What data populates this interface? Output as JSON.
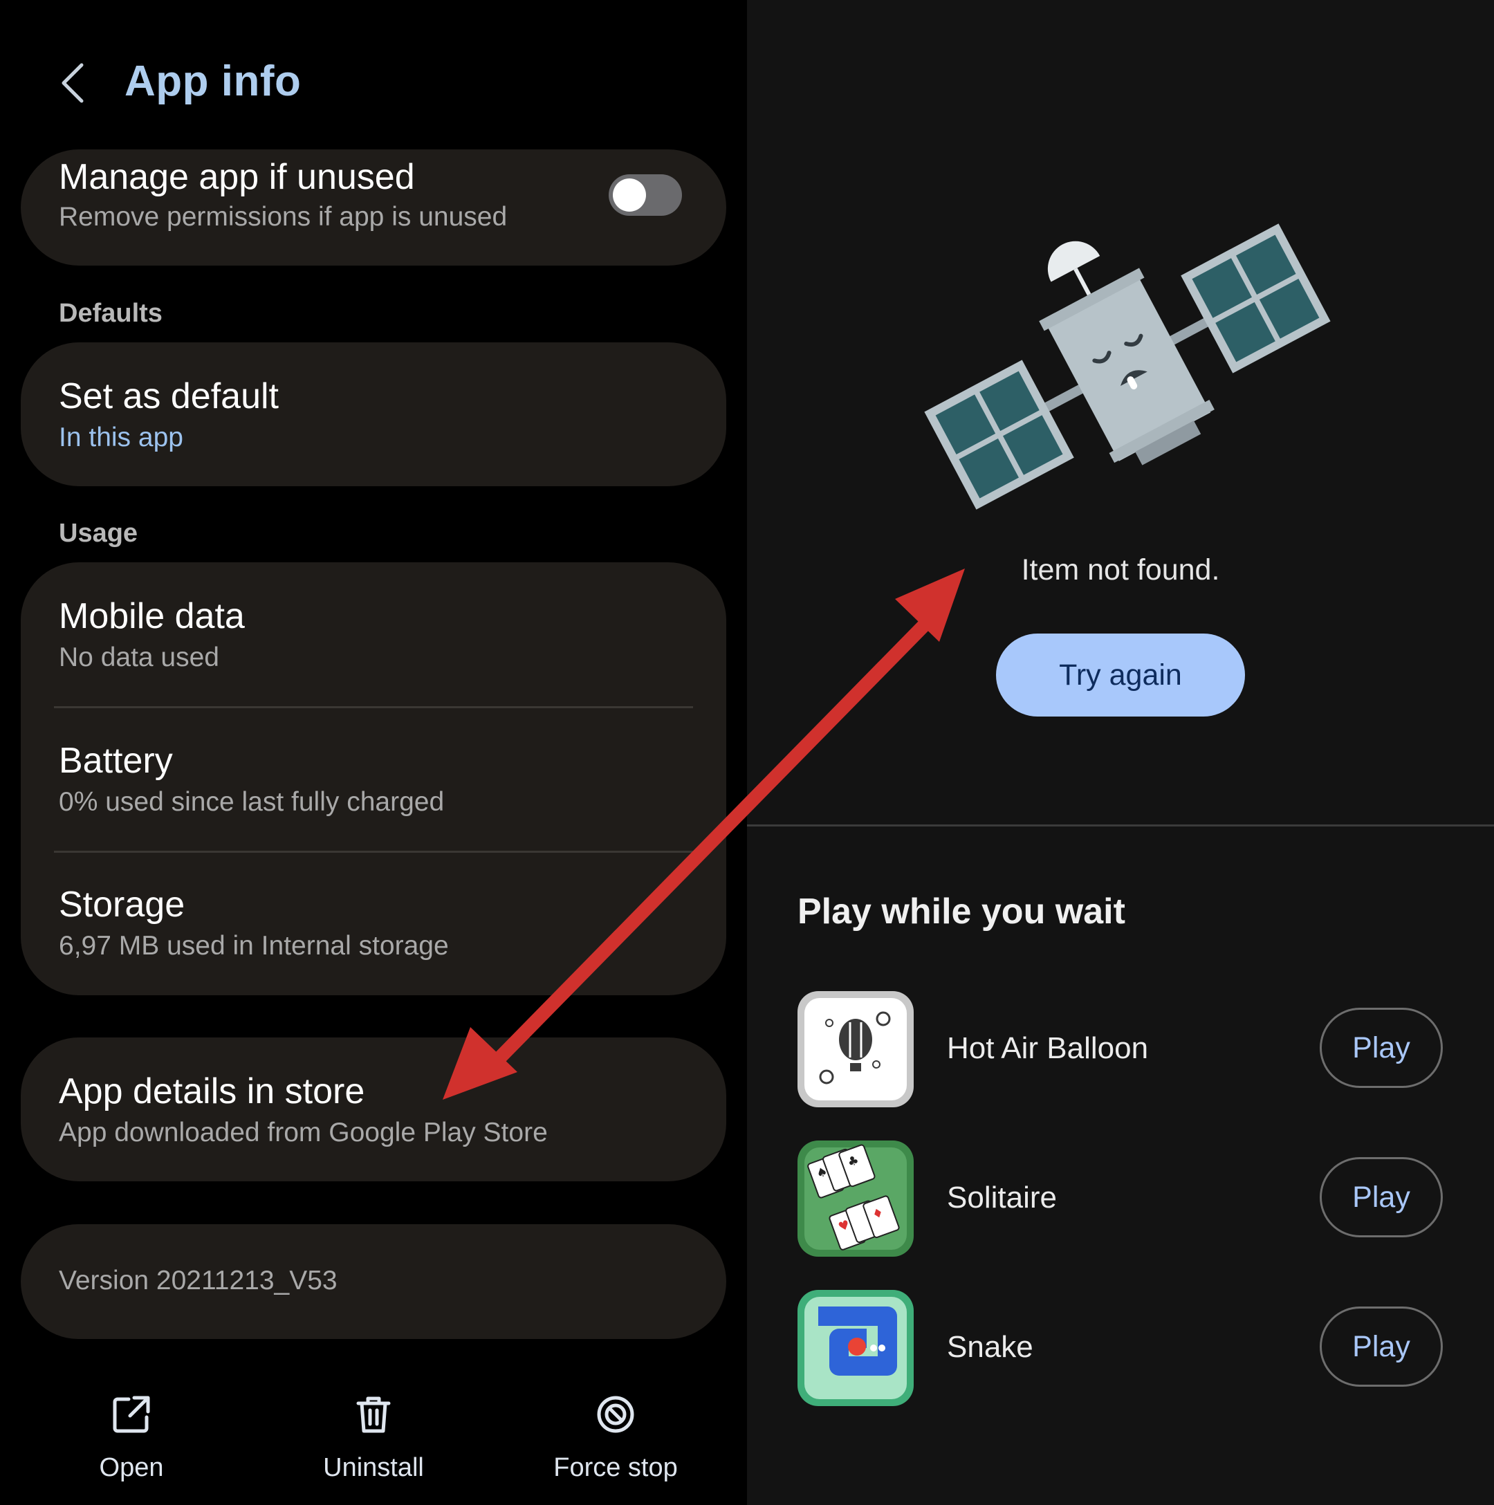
{
  "app_info": {
    "title": "App info",
    "manage_unused": {
      "title": "Manage app if unused",
      "subtitle": "Remove permissions if app is unused",
      "toggle_on": false
    },
    "sections": {
      "defaults": "Defaults",
      "usage": "Usage"
    },
    "set_default": {
      "title": "Set as default",
      "subtitle": "In this app"
    },
    "mobile_data": {
      "title": "Mobile data",
      "subtitle": "No data used"
    },
    "battery": {
      "title": "Battery",
      "subtitle": "0% used since last fully charged"
    },
    "storage": {
      "title": "Storage",
      "subtitle": "6,97 MB used in Internal storage"
    },
    "store_details": {
      "title": "App details in store",
      "subtitle": "App downloaded from Google Play Store"
    },
    "version": "Version 20211213_V53",
    "bottom_actions": {
      "open": "Open",
      "uninstall": "Uninstall",
      "force_stop": "Force stop"
    }
  },
  "play_store": {
    "message": "Item not found.",
    "try_again": "Try again",
    "games_header": "Play while you wait",
    "games": [
      {
        "name": "Hot Air Balloon",
        "button": "Play"
      },
      {
        "name": "Solitaire",
        "button": "Play"
      },
      {
        "name": "Snake",
        "button": "Play"
      }
    ]
  },
  "colors": {
    "title_blue": "#aecdee",
    "card_bg": "#1f1c19",
    "try_again_bg": "#a8c8fb",
    "arrow_red": "#d0312d"
  },
  "icons": [
    "back-icon",
    "open-icon",
    "trash-icon",
    "stop-icon",
    "satellite-illustration"
  ]
}
